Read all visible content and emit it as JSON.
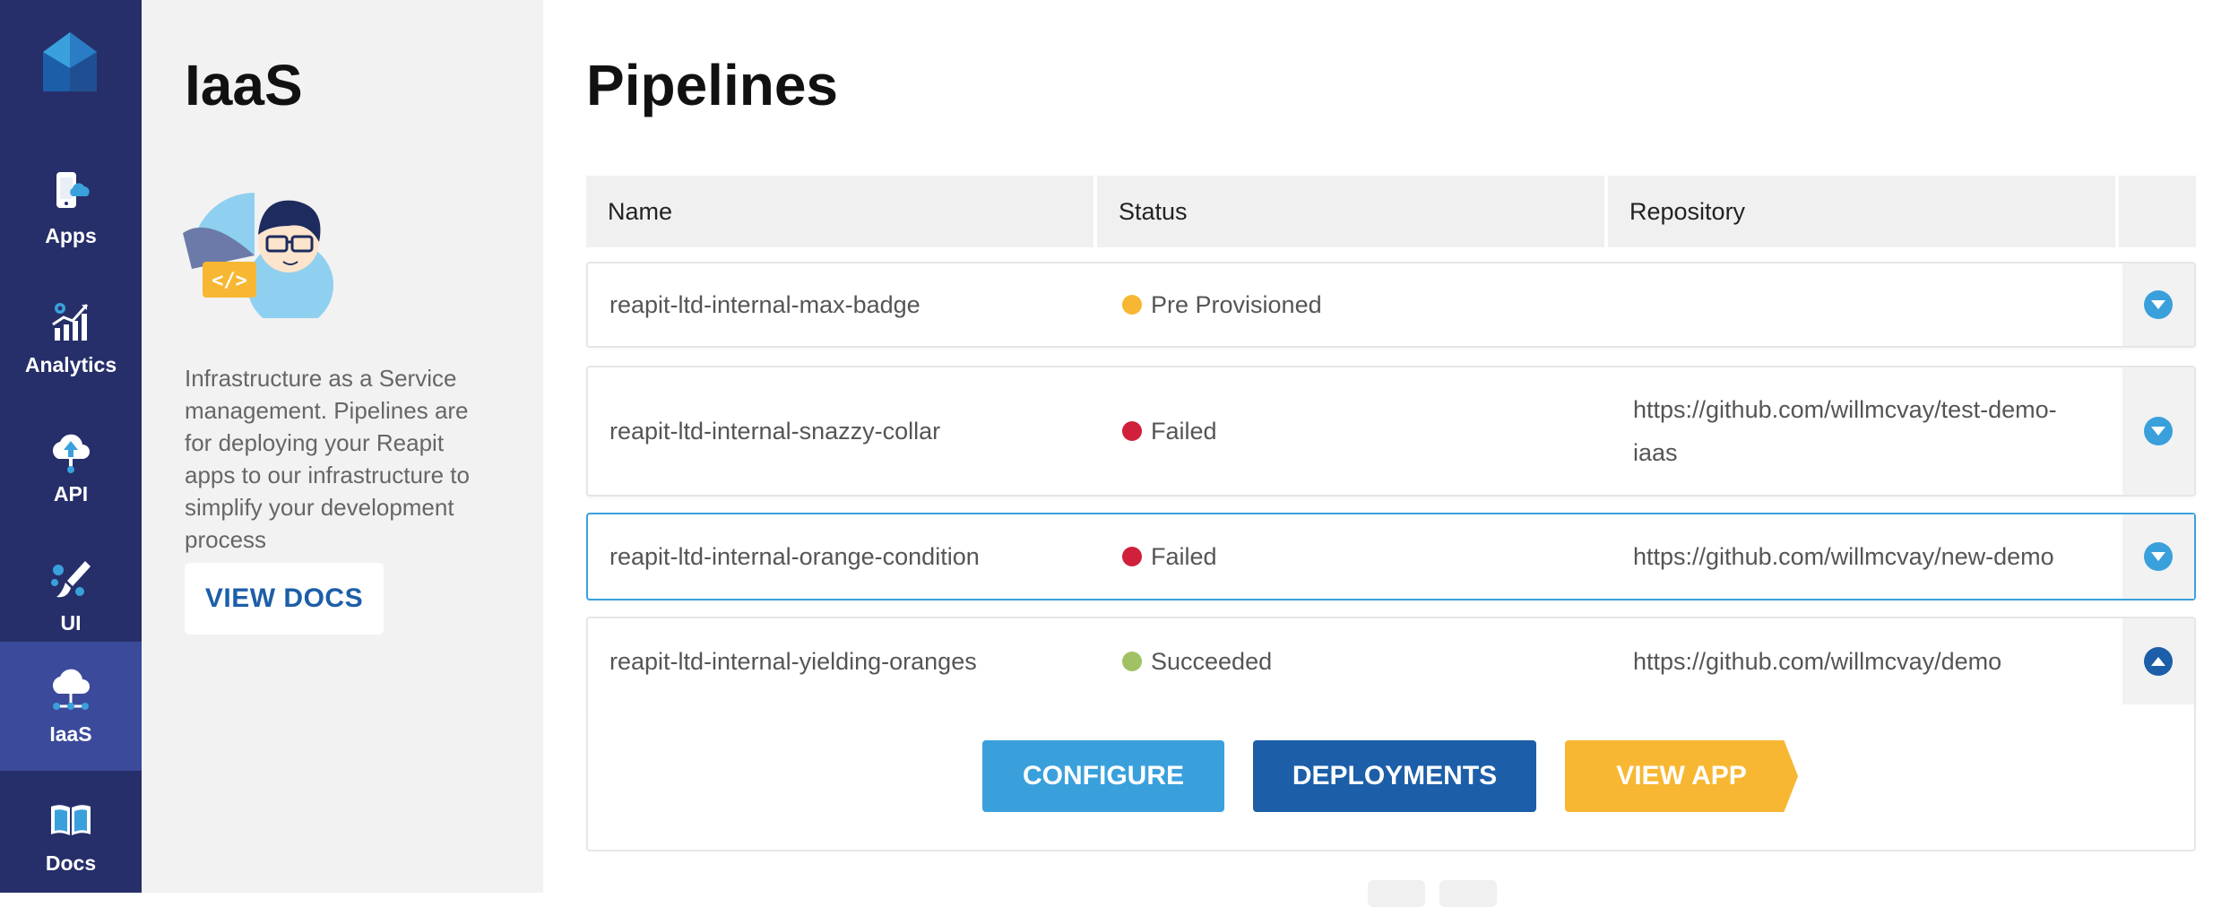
{
  "nav": {
    "items": [
      {
        "label": "Apps",
        "icon": "mobile-cloud-icon"
      },
      {
        "label": "Analytics",
        "icon": "analytics-chart-icon"
      },
      {
        "label": "API",
        "icon": "cloud-upload-icon"
      },
      {
        "label": "UI",
        "icon": "paint-brush-icon"
      },
      {
        "label": "IaaS",
        "icon": "cloud-network-icon"
      },
      {
        "label": "Docs",
        "icon": "open-book-icon"
      }
    ],
    "active": "IaaS"
  },
  "panel": {
    "title": "IaaS",
    "description": "Infrastructure as a Service management. Pipelines are for deploying your Reapit apps to our infrastructure to simplify your development process",
    "docs_button": "VIEW DOCS"
  },
  "main": {
    "title": "Pipelines",
    "columns": [
      "Name",
      "Status",
      "Repository",
      ""
    ],
    "rows": [
      {
        "name": "reapit-ltd-internal-max-badge",
        "status": "Pre Provisioned",
        "status_color": "#f7b733",
        "repository": ""
      },
      {
        "name": "reapit-ltd-internal-snazzy-collar",
        "status": "Failed",
        "status_color": "#d0203b",
        "repository": "https://github.com/willmcvay/test-demo-iaas"
      },
      {
        "name": "reapit-ltd-internal-orange-condition",
        "status": "Failed",
        "status_color": "#d0203b",
        "repository": "https://github.com/willmcvay/new-demo"
      },
      {
        "name": "reapit-ltd-internal-yielding-oranges",
        "status": "Succeeded",
        "status_color": "#a0c264",
        "repository": "https://github.com/willmcvay/demo"
      }
    ],
    "actions": {
      "configure": "CONFIGURE",
      "deployments": "DEPLOYMENTS",
      "view_app": "VIEW APP"
    }
  },
  "colors": {
    "nav_bg": "#262f69",
    "accent_blue": "#3aa0dc",
    "dark_blue": "#1c5ea8",
    "orange": "#f7b733"
  }
}
